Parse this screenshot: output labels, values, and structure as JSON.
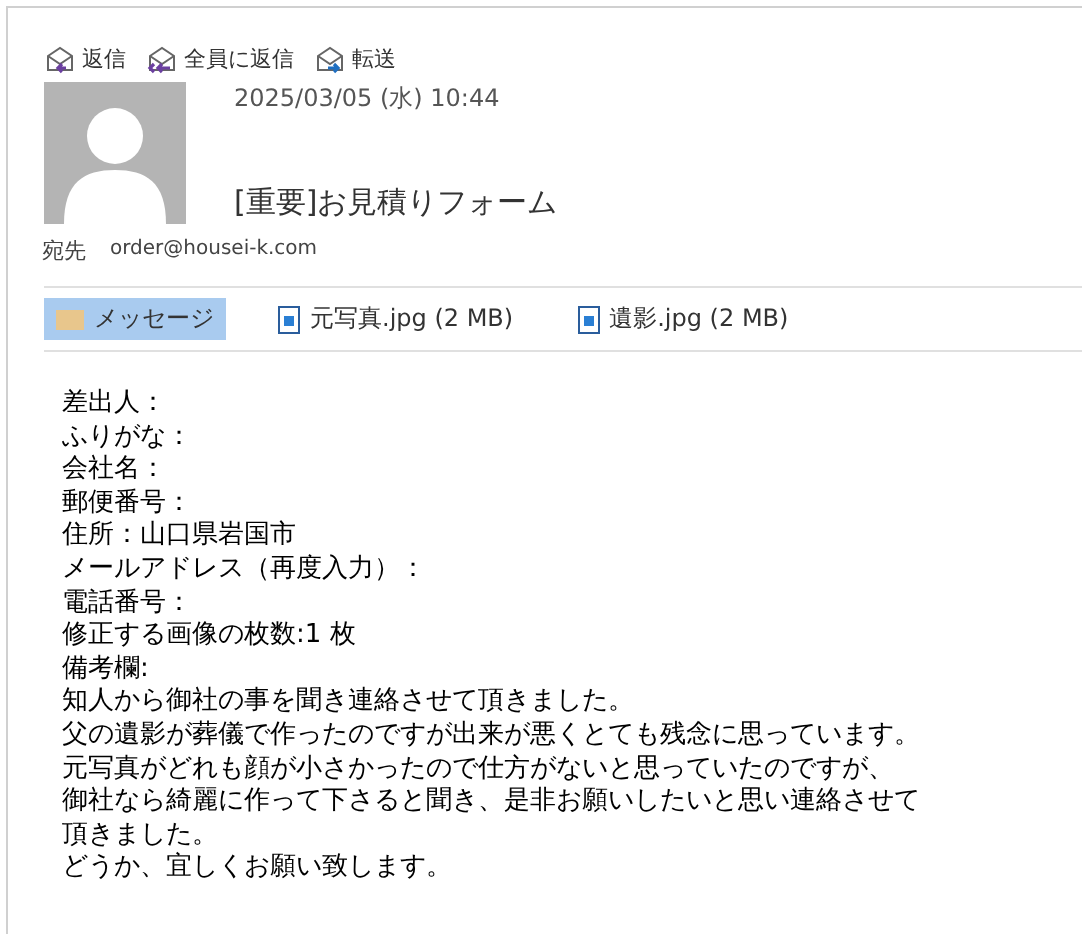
{
  "actions": [
    {
      "kind": "reply",
      "label": "返信"
    },
    {
      "kind": "reply_all",
      "label": "全員に返信"
    },
    {
      "kind": "forward",
      "label": "転送"
    }
  ],
  "message": {
    "date": "2025/03/05 (水) 10:44",
    "subject": "[重要]お見積りフォーム",
    "to_label": "宛先",
    "to": "order@housei-k.com"
  },
  "attachments": [
    {
      "kind": "message",
      "label": "メッセージ",
      "selected": true
    },
    {
      "kind": "file",
      "label": "元写真.jpg (2 MB)",
      "selected": false
    },
    {
      "kind": "file",
      "label": "遺影.jpg (2 MB)",
      "selected": false
    }
  ],
  "body": [
    "差出人：",
    "ふりがな：",
    "会社名：",
    "郵便番号：",
    "住所：山口県岩国市",
    "メールアドレス（再度入力）：",
    "電話番号：",
    "修正する画像の枚数:1 枚",
    "備考欄:",
    "知人から御社の事を聞き連絡させて頂きました。",
    "父の遺影が葬儀で作ったのですが出来が悪くとても残念に思っています。",
    "元写真がどれも顔が小さかったので仕方がないと思っていたのですが、",
    "御社なら綺麗に作って下さると聞き、是非お願いしたいと思い連絡させて",
    "頂きました。",
    "どうか、宜しくお願い致します。"
  ]
}
